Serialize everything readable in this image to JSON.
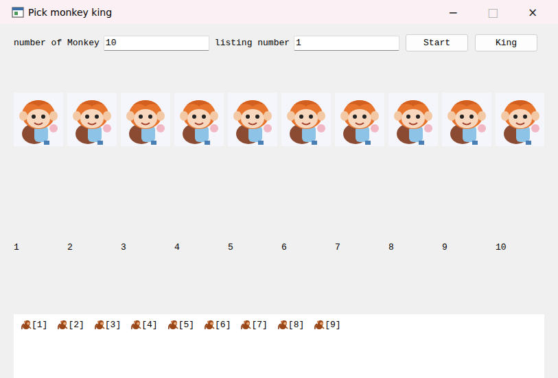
{
  "window": {
    "title": "Pick monkey king",
    "controls": [
      {
        "glyph": "−",
        "disabled": false
      },
      {
        "glyph": "□",
        "disabled": true
      },
      {
        "glyph": "×",
        "disabled": false
      }
    ]
  },
  "form": {
    "monkey_label": "number of Monkey",
    "monkey_count": "10",
    "listing_label": "listing number",
    "listing_value": "1"
  },
  "buttons": [
    "Start",
    "King"
  ],
  "monkeys": [
    {
      "number": "1"
    },
    {
      "number": "2"
    },
    {
      "number": "3"
    },
    {
      "number": "4"
    },
    {
      "number": "5"
    },
    {
      "number": "6"
    },
    {
      "number": "7"
    },
    {
      "number": "8"
    },
    {
      "number": "9"
    },
    {
      "number": "10"
    }
  ],
  "output": [
    "[1]",
    "[2]",
    "[3]",
    "[4]",
    "[5]",
    "[6]",
    "[7]",
    "[8]",
    "[9]"
  ]
}
